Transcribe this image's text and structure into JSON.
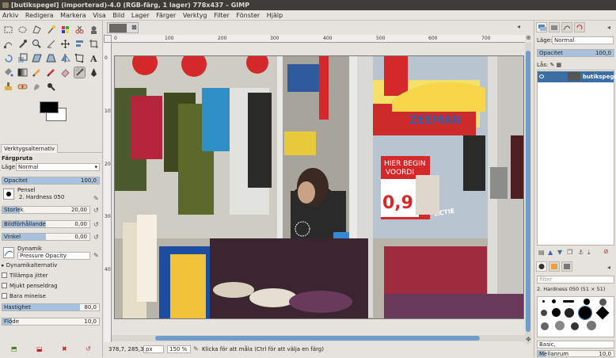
{
  "window": {
    "title": "[butikspegel] (importerad)-4.0 (RGB-färg, 1 lager) 778x437 – GIMP"
  },
  "menu": [
    "Arkiv",
    "Redigera",
    "Markera",
    "Visa",
    "Bild",
    "Lager",
    "Färger",
    "Verktyg",
    "Filter",
    "Fönster",
    "Hjälp"
  ],
  "toolbox": {
    "fg_color": "#000000",
    "bg_color": "#ffffff",
    "tab_label": "Verktygsalternativ",
    "tool_name": "Färgpruta",
    "mode_label": "Läge",
    "mode_value": "Normal",
    "opacity": {
      "label": "Opacitet",
      "value": "100,0",
      "fraction": 1.0
    },
    "brush_label": "Pensel",
    "brush_value": "2. Hardness 050",
    "size": {
      "label": "Storlek",
      "value": "20,00",
      "fraction": 0.2
    },
    "aspect": {
      "label": "Bildförhållande",
      "value": "0,00",
      "fraction": 0.5
    },
    "angle": {
      "label": "Vinkel",
      "value": "0,00",
      "fraction": 0.5
    },
    "dynamics_label": "Dynamik",
    "dynamics_value": "Pressure Opacity",
    "dynamics_options": "Dynamikalternativ",
    "apply_jitter": "Tillämpa jitter",
    "smooth_stroke": "Mjukt penseldrag",
    "incremental": "Bara mineise",
    "rate": {
      "label": "Hastighet",
      "value": "80,0",
      "fraction": 0.8
    },
    "flow": {
      "label": "Flöde",
      "value": "10,0",
      "fraction": 0.1
    }
  },
  "hruler_labels": [
    "0",
    "100",
    "200",
    "300",
    "400",
    "500",
    "600",
    "700"
  ],
  "vruler_labels": [
    "0",
    "100",
    "200",
    "300",
    "400"
  ],
  "image_text": {
    "zeeman": "ZEEMAN",
    "sign1": "HIER BEGIN",
    "sign2": "VOORDI",
    "sign3": "0,9",
    "sign4": "ACTIE"
  },
  "status": {
    "coords": "378,7, 285,3",
    "unit": "px",
    "zoom": "150 %",
    "message": "Klicka för att måla (Ctrl för att välja en färg)"
  },
  "layers_panel": {
    "mode_label": "Läge:",
    "mode_value": "Normal",
    "opacity_label": "Opacitet",
    "opacity_value": "100,0",
    "lock_label": "Lås:",
    "layer_name": "butikspegel.j"
  },
  "brushes_panel": {
    "filter_placeholder": "filter",
    "brush_title": "2. Hardness 050 (51 × 51)",
    "tag_label": "Basic,",
    "spacing_label": "Mellanrum",
    "spacing_value": "10,0"
  }
}
